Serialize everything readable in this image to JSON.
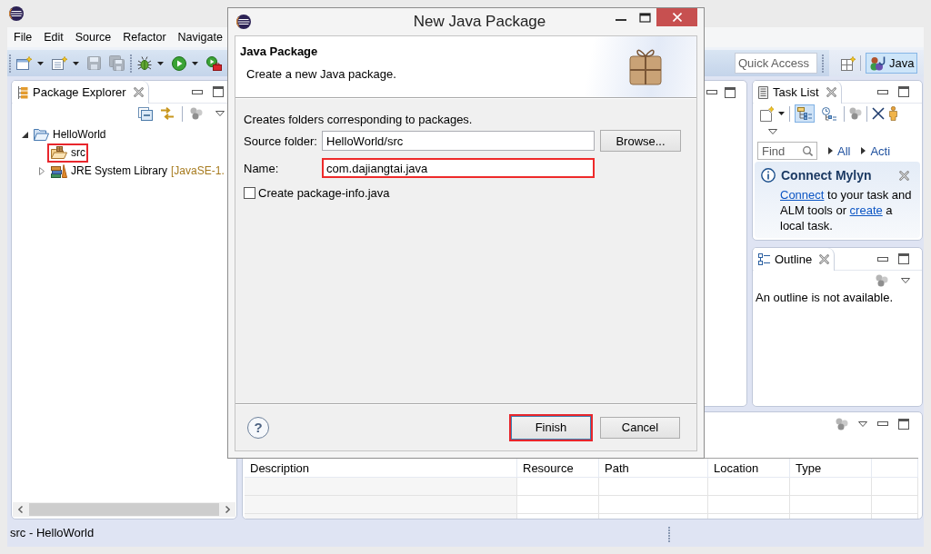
{
  "menu": [
    "File",
    "Edit",
    "Source",
    "Refactor",
    "Navigate"
  ],
  "toolbar": {
    "groups": [
      [
        {
          "kind": "new",
          "dropdown": true,
          "disabled": false
        },
        {
          "kind": "new_java",
          "dropdown": true,
          "disabled": false
        },
        {
          "kind": "save",
          "dropdown": false,
          "disabled": true
        },
        {
          "kind": "save_all",
          "dropdown": false,
          "disabled": true
        }
      ],
      [
        {
          "kind": "debug",
          "dropdown": true,
          "disabled": false
        },
        {
          "kind": "run",
          "dropdown": true,
          "disabled": false
        },
        {
          "kind": "external_tools",
          "dropdown": false,
          "disabled": false
        }
      ]
    ],
    "quick_access": {
      "placeholder": "Quick Access"
    },
    "perspectives": [
      {
        "label": "Java",
        "selected": true
      }
    ]
  },
  "package_explorer": {
    "title": "Package Explorer",
    "tree": [
      {
        "label": "HelloWorld",
        "kind": "project",
        "expanded": true,
        "highlighted": false,
        "children": [
          {
            "label": "src",
            "kind": "source_folder",
            "highlighted": true
          },
          {
            "label": "JRE System Library",
            "decoration": "[JavaSE-1.",
            "kind": "library",
            "expanded": false,
            "highlighted": false
          }
        ]
      }
    ]
  },
  "task_list": {
    "title": "Task List",
    "presentations": [
      {
        "kind": "categorized",
        "selected": true
      },
      {
        "kind": "scheduled",
        "selected": false
      }
    ],
    "find": {
      "placeholder": "Find"
    },
    "filters": [
      "All",
      "Acti"
    ],
    "connect_mylyn": {
      "title": "Connect Mylyn",
      "message": [
        {
          "kind": "link",
          "text": "Connect"
        },
        {
          "kind": "text",
          "text": " to your task and ALM tools or "
        },
        {
          "kind": "link",
          "text": "create"
        },
        {
          "kind": "text",
          "text": " a local task."
        }
      ]
    }
  },
  "outline": {
    "title": "Outline",
    "message": "An outline is not available."
  },
  "problems": {
    "columns": [
      "Description",
      "Resource",
      "Path",
      "Location",
      "Type"
    ]
  },
  "dialog": {
    "title": "New Java Package",
    "heading": "Java Package",
    "subtitle": "Create a new Java package.",
    "description": "Creates folders corresponding to packages.",
    "fields": [
      {
        "label": "Source folder:",
        "value": "HelloWorld/src",
        "highlighted": false,
        "button": "Browse..."
      },
      {
        "label": "Name:",
        "value": "com.dajiangtai.java",
        "highlighted": true
      }
    ],
    "checkbox": {
      "label": "Create package-info.java",
      "checked": false
    },
    "help_button": "?",
    "buttons": [
      {
        "label": "Finish",
        "kind": "default",
        "highlighted": true
      },
      {
        "label": "Cancel",
        "kind": "normal",
        "highlighted": false
      }
    ]
  },
  "status_bar": {
    "text": "src - HelloWorld"
  }
}
